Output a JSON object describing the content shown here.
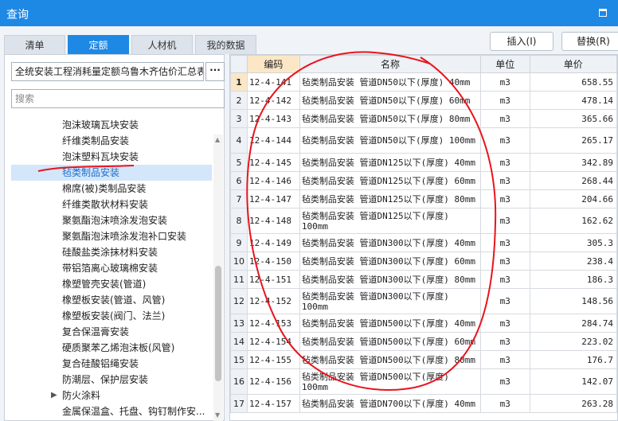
{
  "window": {
    "title": "查询"
  },
  "tabs": [
    {
      "label": "清单",
      "active": false
    },
    {
      "label": "定额",
      "active": true
    },
    {
      "label": "人材机",
      "active": false
    },
    {
      "label": "我的数据",
      "active": false
    }
  ],
  "toolbar": {
    "insert_label": "插入(I)",
    "replace_label": "替换(R)"
  },
  "library": {
    "value": "全统安装工程消耗量定额乌鲁木齐估价汇总表",
    "more_label": "···"
  },
  "search": {
    "placeholder": "搜索"
  },
  "tree": {
    "items": [
      {
        "label": "泡沫玻璃瓦块安装",
        "selected": false
      },
      {
        "label": "纤维类制品安装",
        "selected": false
      },
      {
        "label": "泡沫塑料瓦块安装",
        "selected": false
      },
      {
        "label": "毡类制品安装",
        "selected": true
      },
      {
        "label": "棉席(被)类制品安装",
        "selected": false
      },
      {
        "label": "纤维类散状材料安装",
        "selected": false
      },
      {
        "label": "聚氨酯泡沫喷涂发泡安装",
        "selected": false
      },
      {
        "label": "聚氨酯泡沫喷涂发泡补口安装",
        "selected": false
      },
      {
        "label": "硅酸盐类涂抹材料安装",
        "selected": false
      },
      {
        "label": "带铝箔离心玻璃棉安装",
        "selected": false
      },
      {
        "label": "橡塑管壳安装(管道)",
        "selected": false
      },
      {
        "label": "橡塑板安装(管道、风管)",
        "selected": false
      },
      {
        "label": "橡塑板安装(阀门、法兰)",
        "selected": false
      },
      {
        "label": "复合保温膏安装",
        "selected": false
      },
      {
        "label": "硬质聚苯乙烯泡沫板(风管)",
        "selected": false
      },
      {
        "label": "复合硅酸铝绳安装",
        "selected": false
      },
      {
        "label": "防潮层、保护层安装",
        "selected": false
      },
      {
        "label": "防火涂料",
        "selected": false,
        "collapsed": true
      },
      {
        "label": "金属保温盒、托盘、钩钉制作安...",
        "selected": false
      }
    ]
  },
  "table": {
    "headers": {
      "code": "编码",
      "name": "名称",
      "unit": "单位",
      "price": "单价"
    },
    "rows": [
      {
        "n": "1",
        "code": "12-4-141",
        "name": "毡类制品安装 管道DN50以下(厚度) 40mm",
        "unit": "m3",
        "price": "658.55"
      },
      {
        "n": "2",
        "code": "12-4-142",
        "name": "毡类制品安装 管道DN50以下(厚度) 60mm",
        "unit": "m3",
        "price": "478.14"
      },
      {
        "n": "3",
        "code": "12-4-143",
        "name": "毡类制品安装 管道DN50以下(厚度) 80mm",
        "unit": "m3",
        "price": "365.66"
      },
      {
        "n": "4",
        "code": "12-4-144",
        "name": "毡类制品安装 管道DN50以下(厚度) 100mm",
        "unit": "m3",
        "price": "265.17"
      },
      {
        "n": "5",
        "code": "12-4-145",
        "name": "毡类制品安装 管道DN125以下(厚度) 40mm",
        "unit": "m3",
        "price": "342.89"
      },
      {
        "n": "6",
        "code": "12-4-146",
        "name": "毡类制品安装 管道DN125以下(厚度) 60mm",
        "unit": "m3",
        "price": "268.44"
      },
      {
        "n": "7",
        "code": "12-4-147",
        "name": "毡类制品安装 管道DN125以下(厚度) 80mm",
        "unit": "m3",
        "price": "204.66"
      },
      {
        "n": "8",
        "code": "12-4-148",
        "name": "毡类制品安装 管道DN125以下(厚度) 100mm",
        "unit": "m3",
        "price": "162.62"
      },
      {
        "n": "9",
        "code": "12-4-149",
        "name": "毡类制品安装 管道DN300以下(厚度) 40mm",
        "unit": "m3",
        "price": "305.3"
      },
      {
        "n": "10",
        "code": "12-4-150",
        "name": "毡类制品安装 管道DN300以下(厚度) 60mm",
        "unit": "m3",
        "price": "238.4"
      },
      {
        "n": "11",
        "code": "12-4-151",
        "name": "毡类制品安装 管道DN300以下(厚度) 80mm",
        "unit": "m3",
        "price": "186.3"
      },
      {
        "n": "12",
        "code": "12-4-152",
        "name": "毡类制品安装 管道DN300以下(厚度) 100mm",
        "unit": "m3",
        "price": "148.56"
      },
      {
        "n": "13",
        "code": "12-4-153",
        "name": "毡类制品安装 管道DN500以下(厚度) 40mm",
        "unit": "m3",
        "price": "284.74"
      },
      {
        "n": "14",
        "code": "12-4-154",
        "name": "毡类制品安装 管道DN500以下(厚度) 60mm",
        "unit": "m3",
        "price": "223.02"
      },
      {
        "n": "15",
        "code": "12-4-155",
        "name": "毡类制品安装 管道DN500以下(厚度) 80mm",
        "unit": "m3",
        "price": "176.7"
      },
      {
        "n": "16",
        "code": "12-4-156",
        "name": "毡类制品安装 管道DN500以下(厚度) 100mm",
        "unit": "m3",
        "price": "142.07"
      },
      {
        "n": "17",
        "code": "12-4-157",
        "name": "毡类制品安装 管道DN700以下(厚度) 40mm",
        "unit": "m3",
        "price": "263.28"
      }
    ]
  },
  "colors": {
    "accent": "#1e88e5",
    "annotation": "#e8141c",
    "selected_bg": "#d3e6fa"
  }
}
